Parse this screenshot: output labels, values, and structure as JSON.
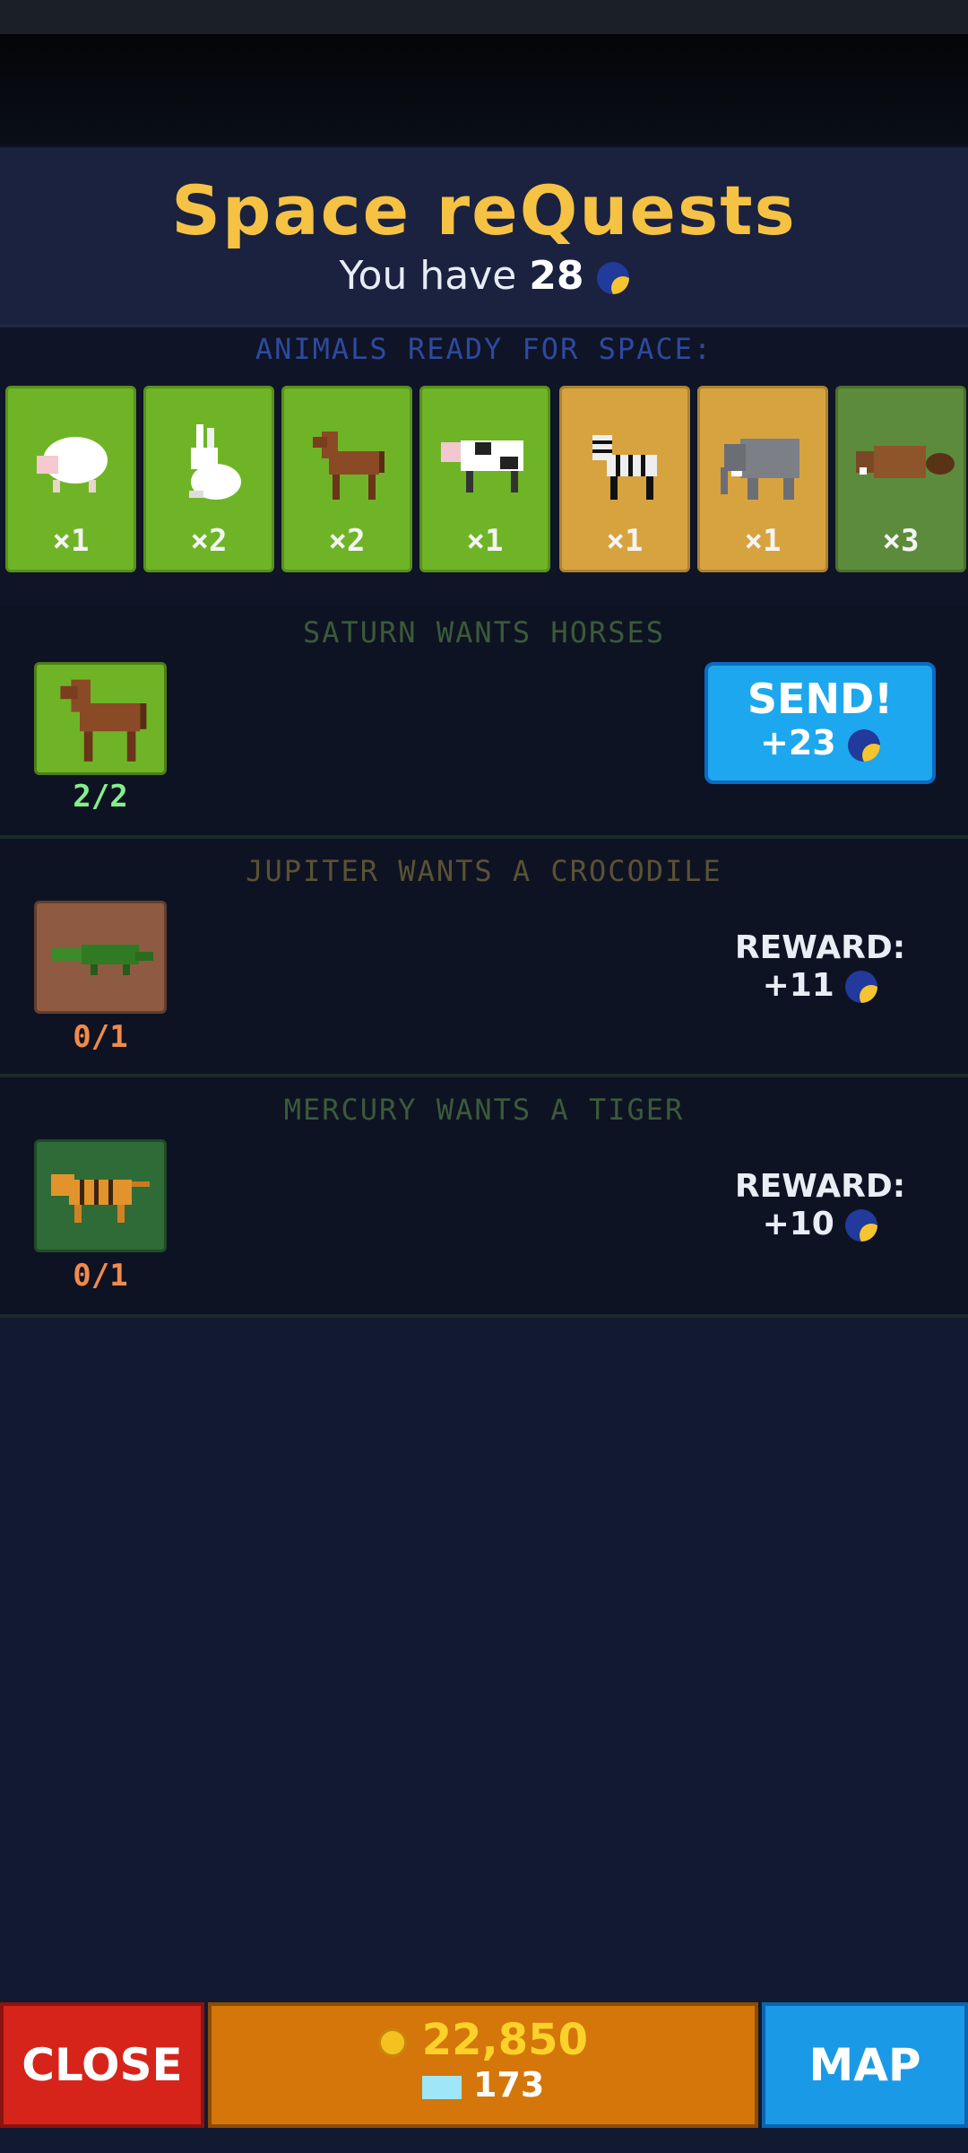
{
  "header": {
    "title": "Space reQuests",
    "subtitle_prefix": "You have",
    "currency_amount": "28"
  },
  "ready": {
    "title": "ANIMALS READY FOR SPACE:",
    "animals": [
      {
        "name": "sheep",
        "count": "×1",
        "bg": "#6fb426"
      },
      {
        "name": "rabbit",
        "count": "×2",
        "bg": "#6fb426"
      },
      {
        "name": "horse",
        "count": "×2",
        "bg": "#6fb426"
      },
      {
        "name": "cow",
        "count": "×1",
        "bg": "#6fb426"
      },
      {
        "name": "zebra",
        "count": "×1",
        "bg": "#d7a33f"
      },
      {
        "name": "elephant",
        "count": "×1",
        "bg": "#d7a33f"
      },
      {
        "name": "beaver",
        "count": "×3",
        "bg": "#5c8c3b"
      }
    ]
  },
  "requests": [
    {
      "title": "SATURN WANTS HORSES",
      "title_color": "#3c5a3a",
      "animal": "horse",
      "progress": "2/2",
      "progress_color": "#84ef8a",
      "tile_bg": "#6fb426",
      "action": "SEND!",
      "reward": "+23"
    },
    {
      "title": "JUPITER WANTS A CROCODILE",
      "title_color": "#5a5234",
      "animal": "crocodile",
      "progress": "0/1",
      "progress_color": "#f08a4b",
      "tile_bg": "#8e5a42",
      "reward_label": "REWARD:",
      "reward": "+11"
    },
    {
      "title": "MERCURY WANTS A TIGER",
      "title_color": "#3c5a3a",
      "animal": "tiger",
      "progress": "0/1",
      "progress_color": "#f08a4b",
      "tile_bg": "#2f6b36",
      "reward_label": "REWARD:",
      "reward": "+10"
    }
  ],
  "bottom": {
    "close_label": "CLOSE",
    "coins": "22,850",
    "gems": "173",
    "map_label": "MAP"
  }
}
